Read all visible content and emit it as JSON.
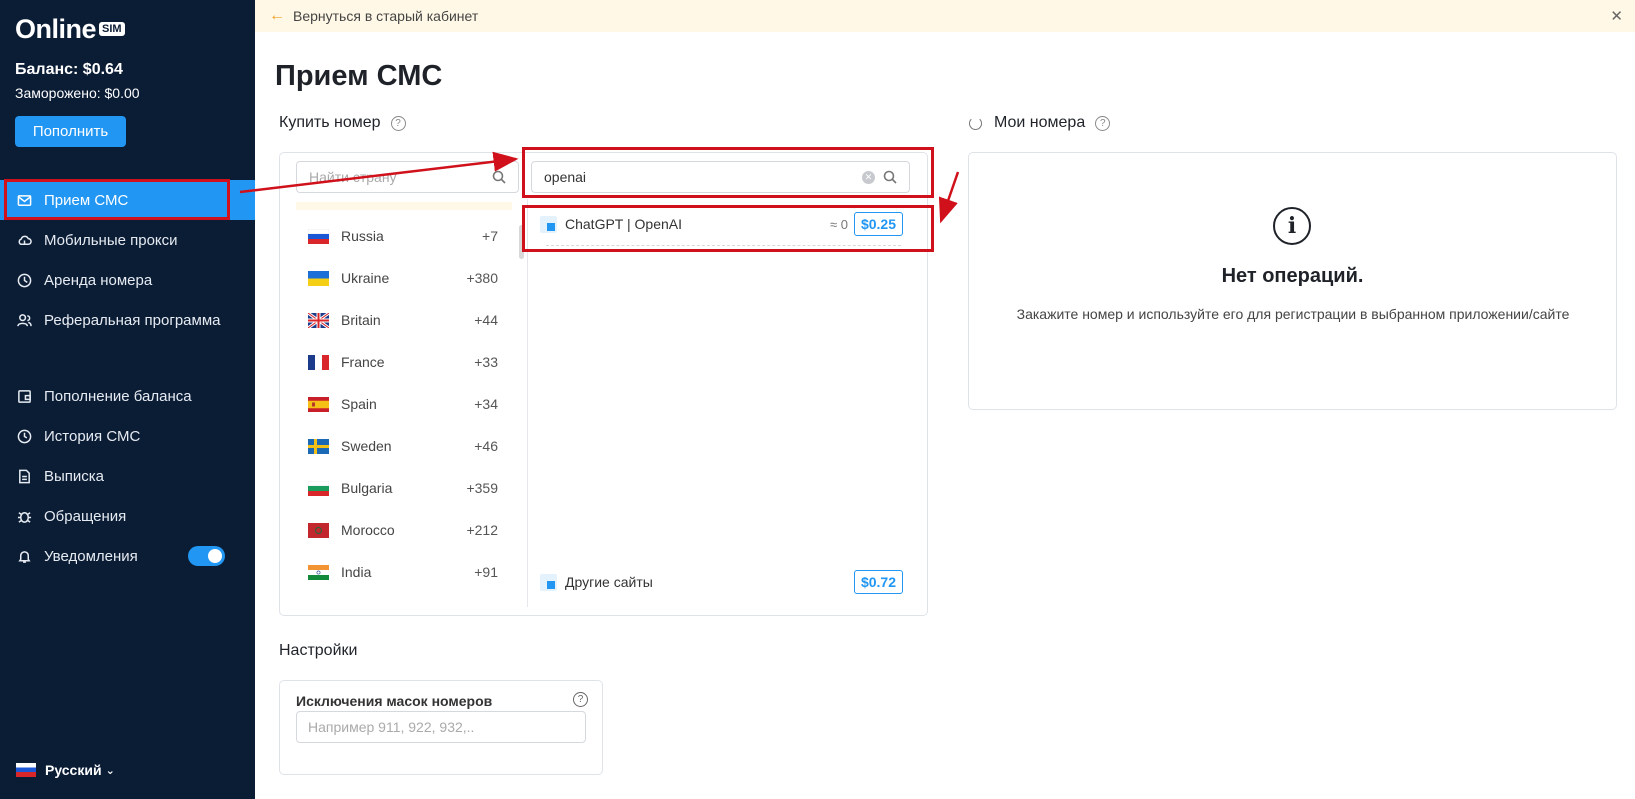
{
  "sidebar": {
    "logo_text": "Online",
    "logo_badge": "SIM",
    "balance": "Баланс: $0.64",
    "frozen": "Заморожено: $0.00",
    "topup_label": "Пополнить",
    "nav_main": [
      {
        "label": "Прием СМС",
        "icon": "envelope-icon",
        "active": true
      },
      {
        "label": "Мобильные прокси",
        "icon": "cloud-icon"
      },
      {
        "label": "Аренда номера",
        "icon": "clock-icon"
      },
      {
        "label": "Реферальная программа",
        "icon": "users-icon"
      }
    ],
    "nav_secondary": [
      {
        "label": "Пополнение баланса",
        "icon": "wallet-icon"
      },
      {
        "label": "История СМС",
        "icon": "history-icon"
      },
      {
        "label": "Выписка",
        "icon": "document-icon"
      },
      {
        "label": "Обращения",
        "icon": "bug-icon"
      },
      {
        "label": "Уведомления",
        "icon": "bell-icon",
        "toggle_on": true
      }
    ],
    "language": "Русский"
  },
  "banner": {
    "text": "Вернуться в старый кабинет",
    "close": "✕"
  },
  "page_title": "Прием СМС",
  "buy": {
    "label": "Купить номер",
    "country_search_placeholder": "Найти страну",
    "service_search_value": "openai",
    "countries": [
      {
        "name": "Russia",
        "code": "+7",
        "flag": "ru"
      },
      {
        "name": "Ukraine",
        "code": "+380",
        "flag": "ua"
      },
      {
        "name": "Britain",
        "code": "+44",
        "flag": "gb"
      },
      {
        "name": "France",
        "code": "+33",
        "flag": "fr"
      },
      {
        "name": "Spain",
        "code": "+34",
        "flag": "es"
      },
      {
        "name": "Sweden",
        "code": "+46",
        "flag": "se"
      },
      {
        "name": "Bulgaria",
        "code": "+359",
        "flag": "bg"
      },
      {
        "name": "Morocco",
        "code": "+212",
        "flag": "ma"
      },
      {
        "name": "India",
        "code": "+91",
        "flag": "in"
      }
    ],
    "service": {
      "name": "ChatGPT | OpenAI",
      "count": "≈ 0",
      "price": "$0.25"
    },
    "other": {
      "name": "Другие сайты",
      "price": "$0.72"
    }
  },
  "my_numbers": {
    "label": "Мои номера",
    "empty_title": "Нет операций.",
    "empty_text": "Закажите номер и используйте его для регистрации в выбранном приложении/сайте"
  },
  "settings": {
    "label": "Настройки",
    "masks_label": "Исключения масок номеров",
    "masks_placeholder": "Например 911, 922, 932,.."
  },
  "colors": {
    "sidebar_bg": "#0b1c35",
    "accent": "#2196f3",
    "annotation": "#d0101a",
    "banner_bg": "#fff8e6"
  }
}
